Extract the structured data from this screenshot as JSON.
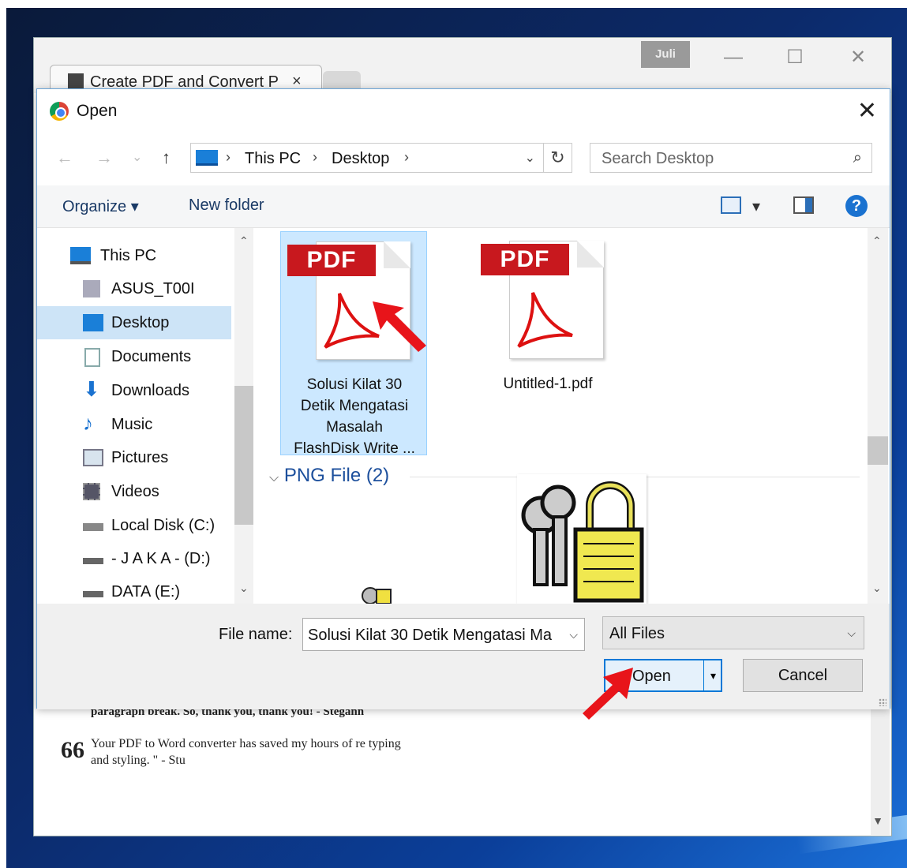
{
  "browser": {
    "tab_title": "Create PDF and Convert P",
    "tab_close": "×",
    "user_badge": "Juli",
    "minimize": "—",
    "maximize": "☐",
    "close": "✕",
    "page_text_1": "paragraph break. So, thank you, thank you! - Stegann",
    "page_text_2": "Your PDF to Word converter has saved my hours of re typing",
    "page_text_3": "and styling. \" - Stu",
    "quote_mark": "66"
  },
  "dialog": {
    "title": "Open",
    "close": "✕",
    "nav": {
      "back": "←",
      "forward": "→",
      "recent": "⌄",
      "up": "↑"
    },
    "breadcrumb": [
      "This PC",
      "Desktop"
    ],
    "crumb_sep": "›",
    "addr_dropdown": "⌄",
    "refresh": "↻",
    "search_placeholder": "Search Desktop",
    "search_icon": "⌕",
    "toolbar": {
      "organize": "Organize ▾",
      "new_folder": "New folder",
      "view_dropdown": "▾",
      "help": "?"
    },
    "nav_pane": [
      {
        "label": "This PC",
        "icon": "monitor-icon",
        "selected": false
      },
      {
        "label": "ASUS_T00I",
        "icon": "phone-icon",
        "selected": false
      },
      {
        "label": "Desktop",
        "icon": "desktop-icon",
        "selected": true
      },
      {
        "label": "Documents",
        "icon": "documents-icon",
        "selected": false
      },
      {
        "label": "Downloads",
        "icon": "downloads-icon",
        "selected": false
      },
      {
        "label": "Music",
        "icon": "music-icon",
        "selected": false
      },
      {
        "label": "Pictures",
        "icon": "pictures-icon",
        "selected": false
      },
      {
        "label": "Videos",
        "icon": "videos-icon",
        "selected": false
      },
      {
        "label": "Local Disk (C:)",
        "icon": "local-disk-icon",
        "selected": false
      },
      {
        "label": "- J A K A - (D:)",
        "icon": "drive-icon",
        "selected": false
      },
      {
        "label": "DATA (E:)",
        "icon": "drive-icon",
        "selected": false
      }
    ],
    "files": [
      {
        "badge": "PDF",
        "name": [
          "Solusi Kilat 30",
          "Detik Mengatasi",
          "Masalah",
          "FlashDisk Write ..."
        ],
        "selected": true
      },
      {
        "badge": "PDF",
        "name": [
          "Untitled-1.pdf"
        ],
        "selected": false
      }
    ],
    "group_header": "PNG File (2)",
    "group_chevron": "⌵",
    "scroll_up": "⌃",
    "scroll_down": "⌄",
    "file_name_label": "File name:",
    "file_name_value": "Solusi Kilat 30 Detik Mengatasi Ma",
    "file_type": "All Files",
    "dropdown": "⌵",
    "open_label": "Open",
    "open_split": "▾",
    "cancel_label": "Cancel"
  },
  "colors": {
    "accent": "#0078d7",
    "selection": "#cce8ff",
    "pdf_red": "#c8181e",
    "arrow_red": "#e8141a"
  }
}
